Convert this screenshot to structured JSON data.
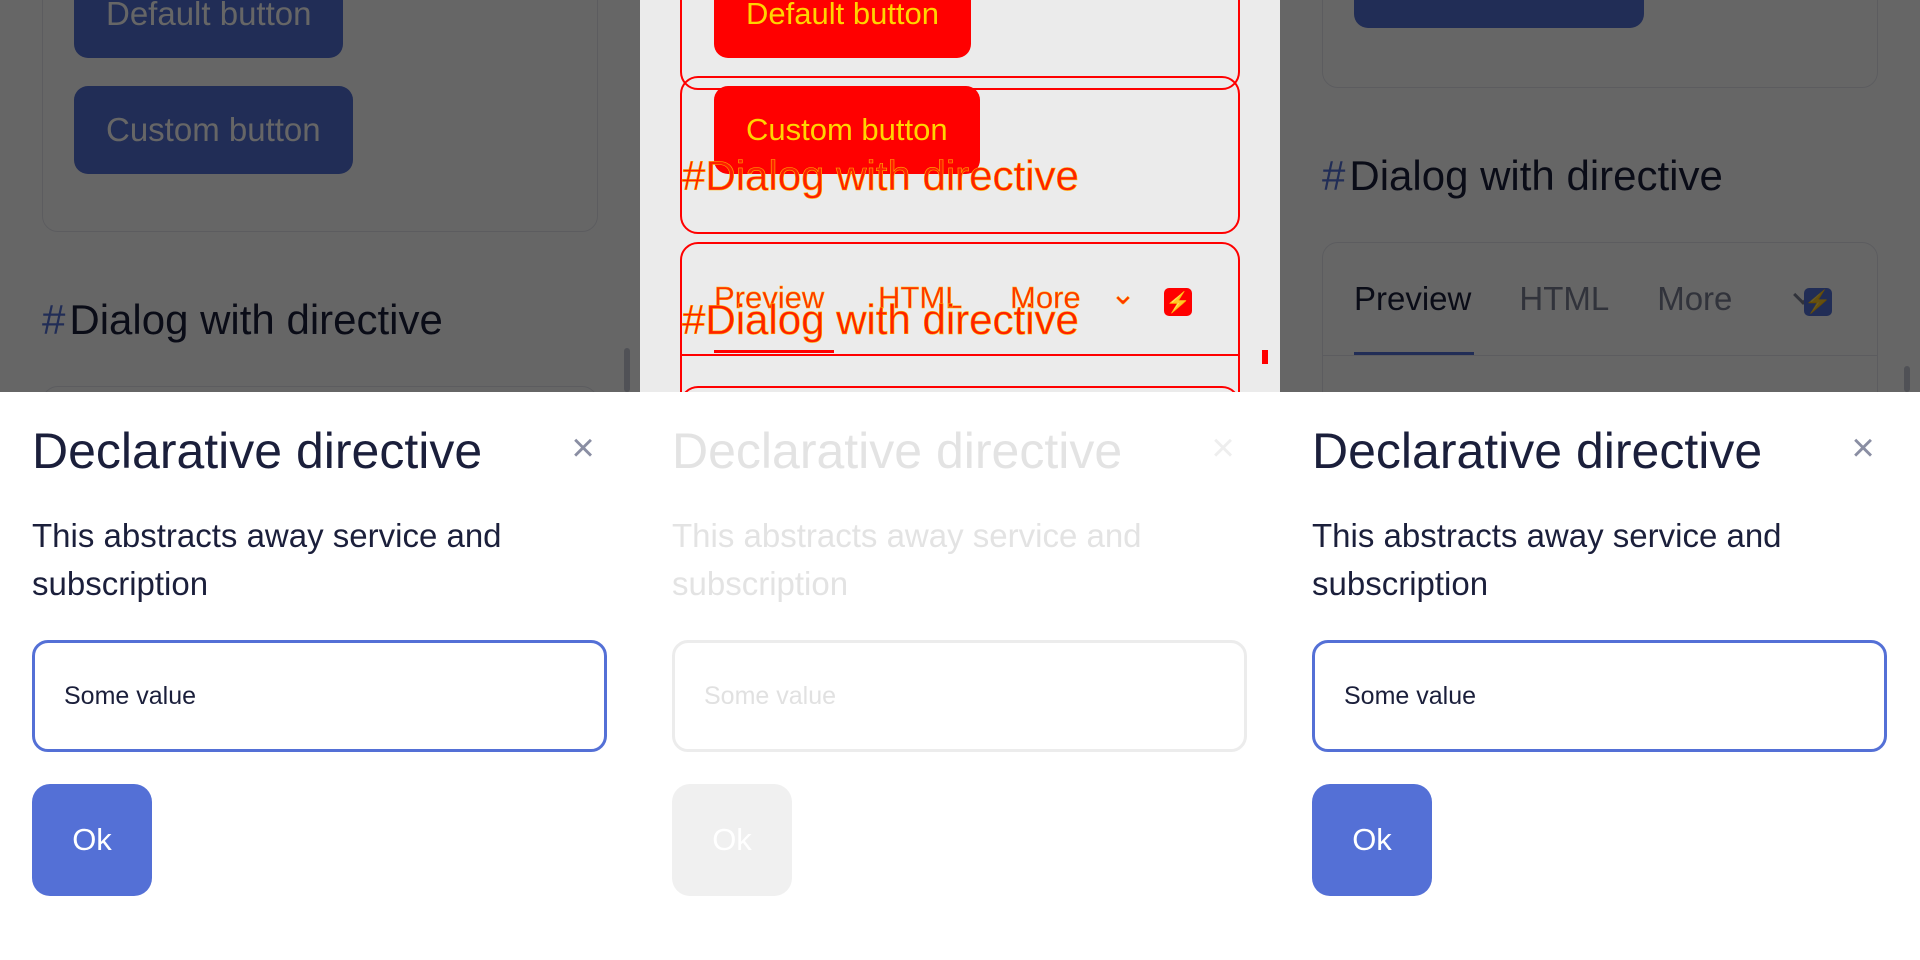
{
  "background": {
    "default_button": "Default button",
    "custom_button": "Custom button",
    "section_heading_hash": "#",
    "section_heading": "Dialog with directive",
    "tabs": [
      "Preview",
      "HTML",
      "More"
    ]
  },
  "dialog": {
    "title": "Declarative directive",
    "close_glyph": "×",
    "description": "This abstracts away service and subscription",
    "input_value": "Some value",
    "ok_label": "Ok"
  },
  "icons": {
    "close": "close-icon",
    "bolt": "lightning-icon",
    "chevron": "chevron-down-icon"
  },
  "colors": {
    "accent": "#5470d6",
    "text": "#1b1f3b",
    "debug_red": "#ff0000"
  }
}
